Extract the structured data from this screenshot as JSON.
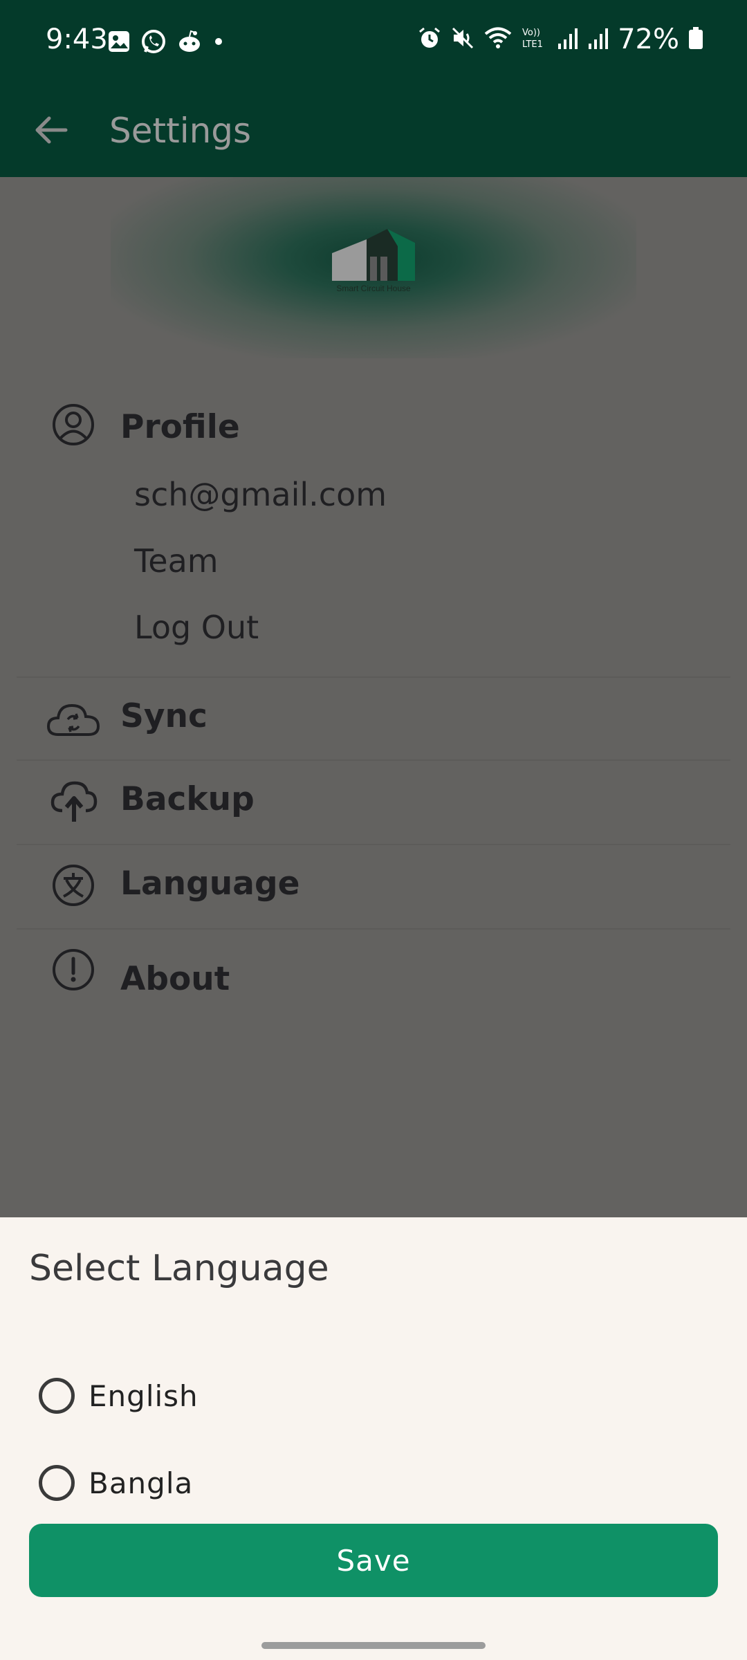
{
  "status_bar": {
    "time": "9:43",
    "battery": "72%"
  },
  "app_bar": {
    "title": "Settings"
  },
  "banner": {
    "logo_text": "Smart Circuit House"
  },
  "settings": {
    "profile": {
      "label": "Profile",
      "email": "sch@gmail.com",
      "team": "Team",
      "logout": "Log Out"
    },
    "sync": {
      "label": "Sync"
    },
    "backup": {
      "label": "Backup"
    },
    "language": {
      "label": "Language"
    },
    "about": {
      "label": "About"
    }
  },
  "language_sheet": {
    "title": "Select Language",
    "options": [
      {
        "label": "English",
        "selected": false
      },
      {
        "label": "Bangla",
        "selected": false
      }
    ],
    "save_label": "Save"
  },
  "colors": {
    "app_bar": "#043a2a",
    "scrim": "#636260",
    "sheet_bg": "#f9f4ef",
    "save_button": "#0f9166"
  }
}
